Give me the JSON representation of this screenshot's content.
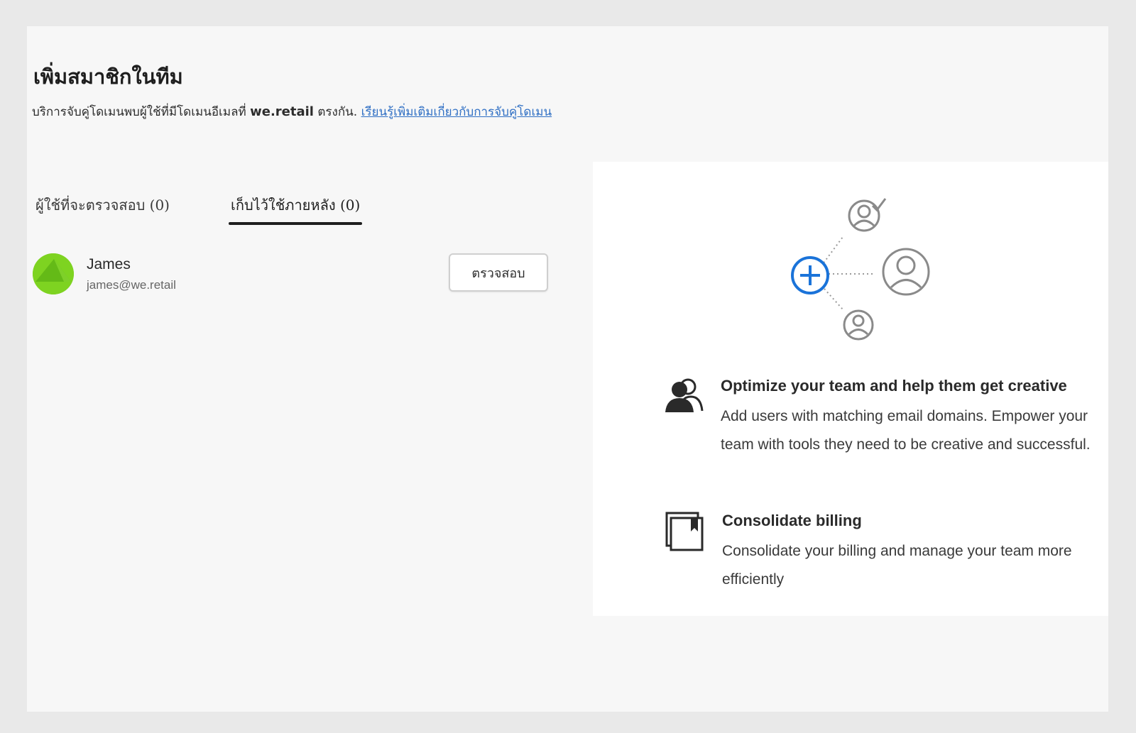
{
  "page": {
    "title": "เพิ่มสมาชิกในทีม",
    "description_prefix": "บริการจับคู่โดเมนพบผู้ใช้ที่มีโดเมนอีเมลที่ ",
    "domain": "we.retail",
    "description_suffix": " ตรงกัน. ",
    "learn_more_link": "เรียนรู้เพิ่มเติมเกี่ยวกับการจับคู่โดเมน"
  },
  "tabs": [
    {
      "label": "ผู้ใช้ที่จะตรวจสอบ (0)",
      "selected": false
    },
    {
      "label": "เก็บไว้ใช้ภายหลัง (0)",
      "selected": true
    }
  ],
  "users": [
    {
      "name": "James",
      "email": "james@we.retail",
      "action_label": "ตรวจสอบ",
      "avatar_color": "#7ed321"
    }
  ],
  "info_card": {
    "illustration_icon": "add-user-network-icon",
    "features": [
      {
        "icon": "team-users-icon",
        "title": "Optimize your team and help them get creative",
        "text": "Add users with matching email domains. Empower your team with tools they need to be creative and successful."
      },
      {
        "icon": "billing-document-icon",
        "title": "Consolidate billing",
        "text": "Consolidate your billing and manage your team more efficiently"
      }
    ]
  },
  "colors": {
    "link": "#2f6fc4",
    "accent_blue": "#1a73d9",
    "avatar_green": "#7ed321"
  }
}
